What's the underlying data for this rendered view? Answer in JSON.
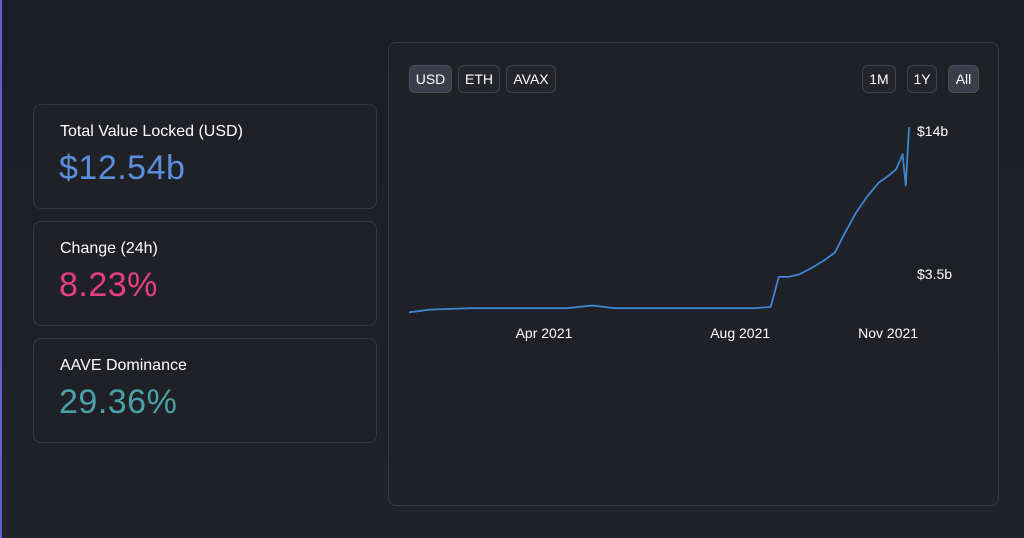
{
  "stats": [
    {
      "label": "Total Value Locked (USD)",
      "value": "$12.54b",
      "color": "#5b8fdd"
    },
    {
      "label": "Change (24h)",
      "value": "8.23%",
      "color": "#e4407e"
    },
    {
      "label": "AAVE Dominance",
      "value": "29.36%",
      "color": "#4aa1a8"
    }
  ],
  "currency_buttons": [
    "USD",
    "ETH",
    "AVAX"
  ],
  "currency_selected": "USD",
  "range_buttons": [
    "1M",
    "1Y",
    "All"
  ],
  "range_selected": "All",
  "chart_data": {
    "type": "line",
    "title": "",
    "xlabel": "",
    "ylabel": "",
    "line_color": "#3e86d4",
    "x_ticks": [
      "Apr 2021",
      "Aug 2021",
      "Nov 2021"
    ],
    "y_ticks": [
      "$14b",
      "$3.5b"
    ],
    "y_ticks_values": [
      14.0,
      3.5
    ],
    "xlim": [
      "2021-01-07",
      "2021-11-14"
    ],
    "ylim": [
      0.65,
      14.6
    ],
    "grid": false,
    "series": [
      {
        "x": [
          "2021-01-07",
          "2021-01-20",
          "2021-02-01",
          "2021-02-15",
          "2021-03-01",
          "2021-03-15",
          "2021-04-01",
          "2021-04-15",
          "2021-05-01",
          "2021-05-15",
          "2021-06-01",
          "2021-06-15",
          "2021-07-01",
          "2021-07-15",
          "2021-08-01",
          "2021-08-10",
          "2021-08-20",
          "2021-08-25",
          "2021-08-31",
          "2021-09-07",
          "2021-09-15",
          "2021-09-22",
          "2021-09-29",
          "2021-10-05",
          "2021-10-12",
          "2021-10-19",
          "2021-10-26",
          "2021-11-02",
          "2021-11-06",
          "2021-11-10",
          "2021-11-12",
          "2021-11-14"
        ],
        "y": [
          0.7,
          0.9,
          0.95,
          1.0,
          1.0,
          1.0,
          1.0,
          1.0,
          1.2,
          1.0,
          1.0,
          1.0,
          1.0,
          1.0,
          1.0,
          1.0,
          1.1,
          3.3,
          3.3,
          3.5,
          4.0,
          4.5,
          5.1,
          6.5,
          8.0,
          9.2,
          10.2,
          10.8,
          11.2,
          12.3,
          10.0,
          14.3
        ]
      }
    ]
  }
}
